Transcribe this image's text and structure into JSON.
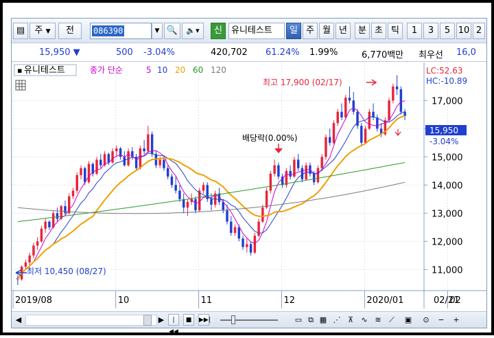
{
  "toolbar": {
    "market_label": "주",
    "prev_label": "전",
    "stock_code": "086390",
    "new_badge": "신",
    "stock_name": "유니테스트",
    "periods": [
      "일",
      "주",
      "월",
      "년",
      "분",
      "초",
      "틱"
    ],
    "active_period": "일",
    "numbers": [
      "1",
      "3",
      "5",
      "10",
      "2"
    ]
  },
  "quote": {
    "price": "15,950",
    "change": "500",
    "change_pct": "-3.04%",
    "volume": "420,702",
    "volume_ratio": "61.24%",
    "turnover": "1.99%",
    "amount": "6,770백만",
    "order_label": "최우선",
    "best_price": "16,0"
  },
  "legend": {
    "name": "유니테스트",
    "ma_label": "종가 단순",
    "ma_periods": [
      {
        "value": "5",
        "color": "#cc00cc"
      },
      {
        "value": "10",
        "color": "#1f3fd0"
      },
      {
        "value": "20",
        "color": "#f0a000"
      },
      {
        "value": "60",
        "color": "#2a9a2a"
      },
      {
        "value": "120",
        "color": "#7a7a7a"
      }
    ]
  },
  "annotations": {
    "high": "최고 17,900 (02/17)",
    "low": "최저 10,450 (08/27)",
    "dividend": "배당락(0.00%)",
    "lc": "LC:52.63",
    "hc": "HC:-10.89",
    "price_tag": "15,950",
    "pct_tag": "-3.04%"
  },
  "colors": {
    "up": "#e8243a",
    "down": "#1f3fd0",
    "price_tag_bg": "#1f3fd0",
    "grid": "#dde3ee"
  },
  "chart_data": {
    "type": "candlestick",
    "y_ticks": [
      11000,
      12000,
      13000,
      14000,
      15000,
      16000,
      17000
    ],
    "y_tick_labels": [
      "11,000",
      "12,000",
      "13,000",
      "14,000",
      "15,000",
      "16,000",
      "17,000"
    ],
    "ylim": [
      10300,
      18350
    ],
    "x_labels": [
      "2019/08",
      "10",
      "11",
      "12",
      "2020/01",
      "02",
      "02/21"
    ],
    "x_label_index": [
      0,
      26,
      47,
      68,
      89,
      110,
      0
    ],
    "candles": [
      [
        10700,
        10800,
        10450,
        10650
      ],
      [
        10650,
        11150,
        10600,
        11100
      ],
      [
        11100,
        11350,
        11000,
        11250
      ],
      [
        11250,
        11600,
        11150,
        11500
      ],
      [
        11500,
        11950,
        11400,
        11850
      ],
      [
        11850,
        12150,
        11700,
        12000
      ],
      [
        12000,
        12550,
        11950,
        12450
      ],
      [
        12450,
        12800,
        12300,
        12700
      ],
      [
        12700,
        12750,
        12400,
        12500
      ],
      [
        12500,
        13100,
        12450,
        13000
      ],
      [
        13000,
        13200,
        12700,
        12800
      ],
      [
        12800,
        13300,
        12750,
        13250
      ],
      [
        13250,
        13450,
        12900,
        13000
      ],
      [
        13000,
        13700,
        12950,
        13600
      ],
      [
        13600,
        13900,
        13500,
        13800
      ],
      [
        13800,
        14450,
        13700,
        14350
      ],
      [
        14350,
        14700,
        14200,
        14600
      ],
      [
        14600,
        14650,
        14000,
        14100
      ],
      [
        14100,
        14850,
        14050,
        14750
      ],
      [
        14750,
        14800,
        14300,
        14400
      ],
      [
        14400,
        15000,
        14350,
        14900
      ],
      [
        14900,
        15100,
        14600,
        14700
      ],
      [
        14700,
        15200,
        14650,
        15100
      ],
      [
        15100,
        15150,
        14700,
        14800
      ],
      [
        14800,
        15300,
        14750,
        15200
      ],
      [
        15200,
        15400,
        15000,
        15300
      ],
      [
        15300,
        15350,
        14900,
        15000
      ],
      [
        15000,
        15200,
        14650,
        14700
      ],
      [
        14700,
        15300,
        14650,
        15200
      ],
      [
        15200,
        15350,
        14900,
        15000
      ],
      [
        15000,
        15100,
        14500,
        14600
      ],
      [
        14600,
        15400,
        14550,
        15300
      ],
      [
        15300,
        15600,
        15100,
        15200
      ],
      [
        15200,
        16100,
        15150,
        15800
      ],
      [
        15800,
        15900,
        15000,
        15100
      ],
      [
        15100,
        15200,
        14600,
        14700
      ],
      [
        14700,
        15000,
        14600,
        14900
      ],
      [
        14900,
        15000,
        14500,
        14600
      ],
      [
        14600,
        14700,
        14200,
        14300
      ],
      [
        14300,
        14400,
        13900,
        14000
      ],
      [
        14000,
        14300,
        13700,
        13800
      ],
      [
        13800,
        14000,
        13400,
        13500
      ],
      [
        13500,
        13700,
        13000,
        13200
      ],
      [
        13200,
        13500,
        12900,
        13400
      ],
      [
        13400,
        13700,
        13300,
        13500
      ],
      [
        13500,
        13600,
        13000,
        13100
      ],
      [
        13100,
        13900,
        13050,
        13800
      ],
      [
        13800,
        14100,
        13700,
        14000
      ],
      [
        14000,
        14100,
        13400,
        13500
      ],
      [
        13500,
        13700,
        13100,
        13300
      ],
      [
        13300,
        13800,
        13200,
        13700
      ],
      [
        13700,
        13900,
        13300,
        13400
      ],
      [
        13400,
        13500,
        13000,
        13100
      ],
      [
        13100,
        13300,
        12600,
        12700
      ],
      [
        12700,
        12900,
        12200,
        12300
      ],
      [
        12300,
        12600,
        12200,
        12500
      ],
      [
        12500,
        12600,
        12000,
        12100
      ],
      [
        12100,
        12200,
        11700,
        11800
      ],
      [
        11800,
        12100,
        11600,
        11900
      ],
      [
        11900,
        12000,
        11500,
        11600
      ],
      [
        11600,
        12300,
        11550,
        12200
      ],
      [
        12200,
        12800,
        12150,
        12700
      ],
      [
        12700,
        13300,
        12650,
        13200
      ],
      [
        13200,
        13900,
        13150,
        13800
      ],
      [
        13800,
        14500,
        13700,
        14400
      ],
      [
        14400,
        14900,
        14300,
        14700
      ],
      [
        14700,
        14800,
        14200,
        14300
      ],
      [
        14300,
        14400,
        13900,
        14000
      ],
      [
        14000,
        14600,
        13900,
        14500
      ],
      [
        14500,
        14700,
        14200,
        14300
      ],
      [
        14300,
        15000,
        14250,
        14900
      ],
      [
        14900,
        15100,
        14500,
        14600
      ],
      [
        14600,
        14700,
        14100,
        14200
      ],
      [
        14200,
        14800,
        14150,
        14700
      ],
      [
        14700,
        14800,
        14300,
        14400
      ],
      [
        14400,
        14500,
        14000,
        14100
      ],
      [
        14100,
        14700,
        14050,
        14600
      ],
      [
        14600,
        15100,
        14500,
        15000
      ],
      [
        15000,
        15800,
        14900,
        15700
      ],
      [
        15700,
        16000,
        15400,
        15500
      ],
      [
        15500,
        16300,
        15450,
        16200
      ],
      [
        16200,
        16700,
        16100,
        16600
      ],
      [
        16600,
        16900,
        16300,
        16400
      ],
      [
        16400,
        17200,
        16350,
        17100
      ],
      [
        17100,
        17500,
        16900,
        17000
      ],
      [
        17000,
        17300,
        16500,
        16600
      ],
      [
        16600,
        16700,
        16000,
        16100
      ],
      [
        16100,
        16200,
        15400,
        15500
      ],
      [
        15500,
        16100,
        15450,
        16000
      ],
      [
        16000,
        16700,
        15950,
        16600
      ],
      [
        16600,
        16900,
        16300,
        16400
      ],
      [
        16400,
        16500,
        15900,
        16000
      ],
      [
        16000,
        16200,
        15700,
        15800
      ],
      [
        15800,
        16400,
        15750,
        16300
      ],
      [
        16300,
        17100,
        16250,
        17000
      ],
      [
        17000,
        17600,
        16900,
        17500
      ],
      [
        17500,
        17900,
        17200,
        17400
      ],
      [
        17400,
        17500,
        16500,
        16600
      ],
      [
        16600,
        16700,
        16300,
        16450
      ]
    ],
    "ma60_start": [
      12700,
      13500,
      14800
    ],
    "ma120_start": [
      13200,
      12500,
      14100
    ]
  },
  "bottom_bar": {
    "icons": [
      "scroll-left-arrow",
      "scroll-right-arrow",
      "first-icon",
      "stop-icon",
      "last-icon",
      "zoom-slider",
      "window-icon",
      "window-restore-icon",
      "window-split-icon",
      "fibonacci-icon",
      "gann-icon",
      "cycle-icon",
      "wave-icon",
      "pattern-icon",
      "camera-icon",
      "magnifier-icon",
      "zoom-out-icon",
      "zoom-in-icon"
    ]
  }
}
